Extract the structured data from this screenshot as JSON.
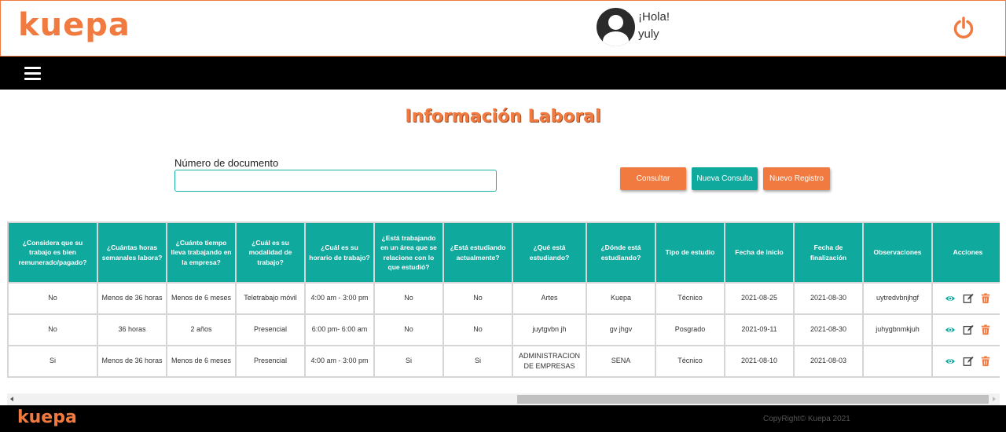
{
  "header": {
    "logo": "kuepa",
    "greeting": "¡Hola!",
    "username": "yuly"
  },
  "page": {
    "title": "Información Laboral"
  },
  "search": {
    "label": "Número de documento",
    "value": ""
  },
  "buttons": {
    "consultar": "Consultar",
    "nueva_consulta": "Nueva Consulta",
    "nuevo_registro": "Nuevo Registro"
  },
  "table": {
    "columns": [
      "¿Considera que su trabajo es bien remunerado/pagado?",
      "¿Cuántas horas semanales labora?",
      "¿Cuánto tiempo lleva trabajando en la empresa?",
      "¿Cuál es su modalidad de trabajo?",
      "¿Cuál es su horario de trabajo?",
      "¿Está trabajando en un área que se relacione con lo que estudió?",
      "¿Está estudiando actualmente?",
      "¿Qué está estudiando?",
      "¿Dónde está estudiando?",
      "Tipo de estudio",
      "Fecha de inicio",
      "Fecha de finalización",
      "Observaciones",
      "Acciones"
    ],
    "rows": [
      [
        "No",
        "Menos de 36 horas",
        "Menos de 6 meses",
        "Teletrabajo móvil",
        "4:00 am - 3:00 pm",
        "No",
        "No",
        "Artes",
        "Kuepa",
        "Técnico",
        "2021-08-25",
        "2021-08-30",
        "uytredvbnjhgf"
      ],
      [
        "No",
        "36 horas",
        "2 años",
        "Presencial",
        "6:00 pm- 6:00 am",
        "No",
        "No",
        "juytgvbn jh",
        "gv jhgv",
        "Posgrado",
        "2021-09-11",
        "2021-08-30",
        "juhygbnmkjuh"
      ],
      [
        "Si",
        "Menos de 36 horas",
        "Menos de 6 meses",
        "Presencial",
        "4:00 am - 3:00 pm",
        "Si",
        "Si",
        "ADMINISTRACION DE EMPRESAS",
        "SENA",
        "Técnico",
        "2021-08-10",
        "2021-08-03",
        ""
      ]
    ]
  },
  "footer": {
    "logo": "kuepa",
    "copyright": "CopyRight© Kuepa 2021"
  },
  "colors": {
    "brand_orange": "#f07a3f",
    "teal": "#0fa99d",
    "black": "#000000"
  },
  "icons": {
    "power": "power-icon",
    "menu": "hamburger-menu-icon",
    "view": "eye-icon",
    "edit": "edit-icon",
    "delete": "trash-icon"
  }
}
